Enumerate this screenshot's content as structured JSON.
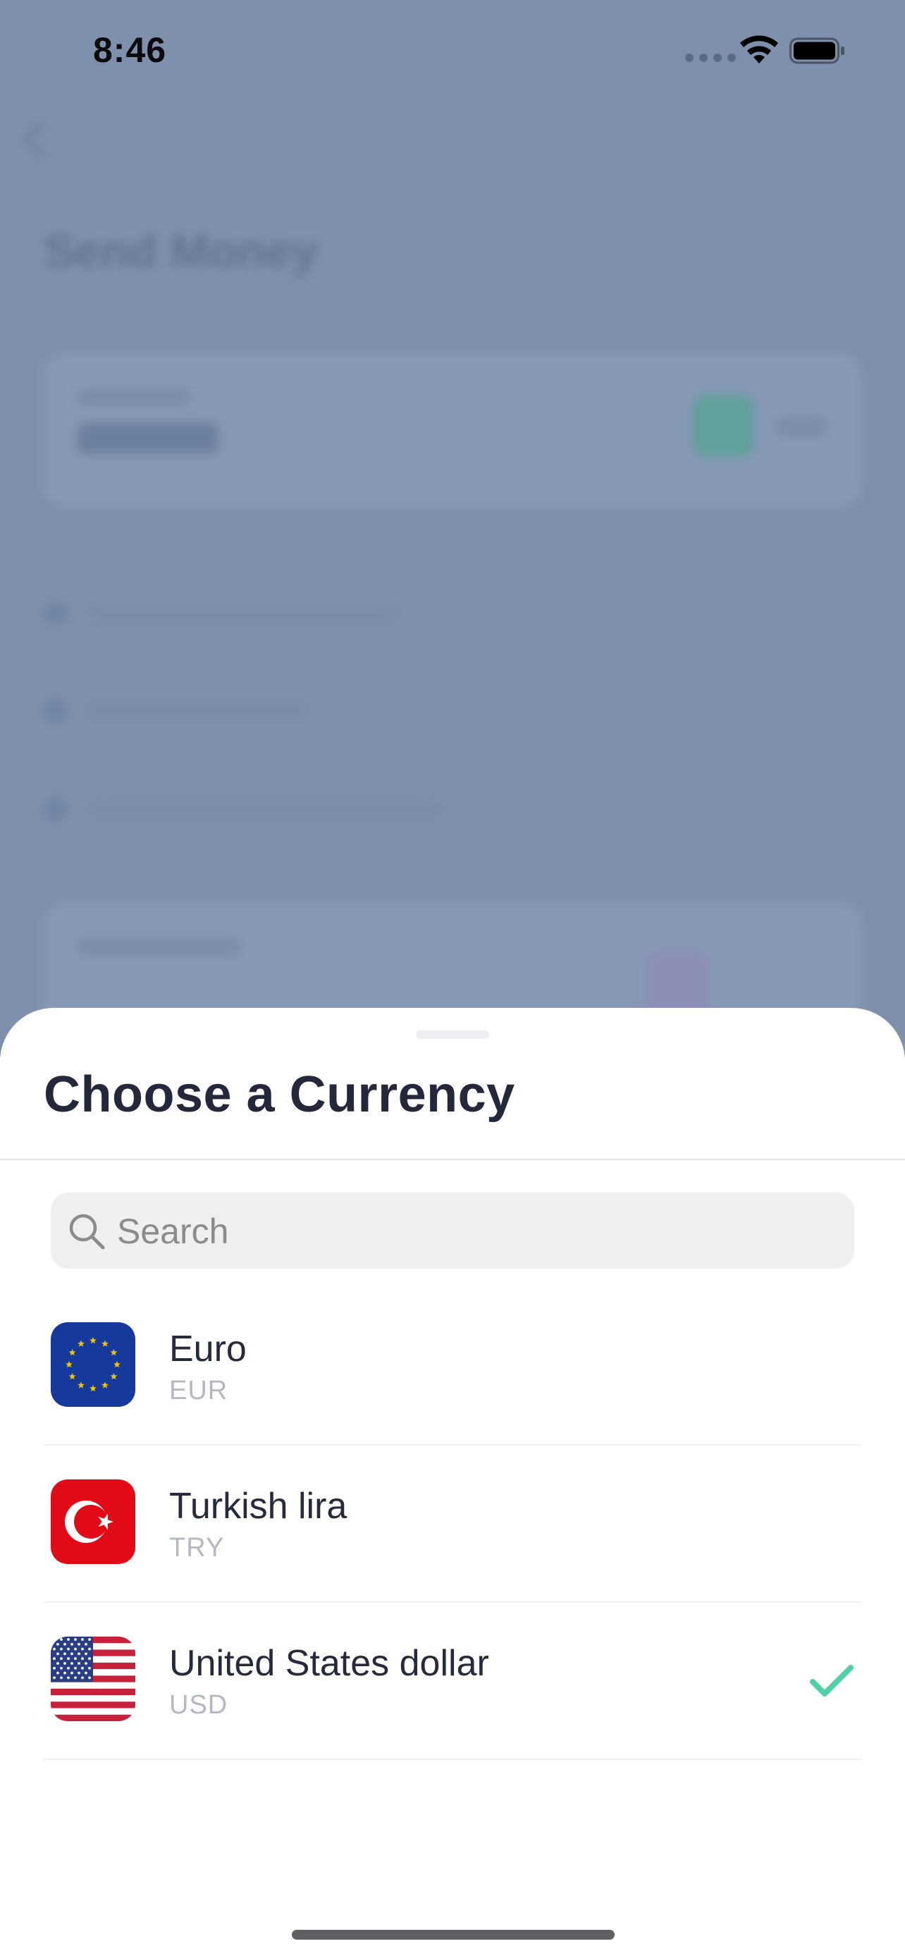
{
  "status_bar": {
    "time": "8:46"
  },
  "background_screen": {
    "title": "Send Money"
  },
  "sheet": {
    "title": "Choose a Currency",
    "search": {
      "placeholder": "Search",
      "value": ""
    },
    "currencies": [
      {
        "name": "Euro",
        "code": "EUR",
        "flag_icon": "eu-flag-icon",
        "selected": false
      },
      {
        "name": "Turkish lira",
        "code": "TRY",
        "flag_icon": "turkey-flag-icon",
        "selected": false
      },
      {
        "name": "United States dollar",
        "code": "USD",
        "flag_icon": "us-flag-icon",
        "selected": true
      }
    ]
  },
  "colors": {
    "overlay_background": "#7f90ad",
    "title_text": "#23293a",
    "subtitle_text": "#b4b8c1",
    "selected_check": "#4fd1a5",
    "search_background": "#efefef"
  }
}
